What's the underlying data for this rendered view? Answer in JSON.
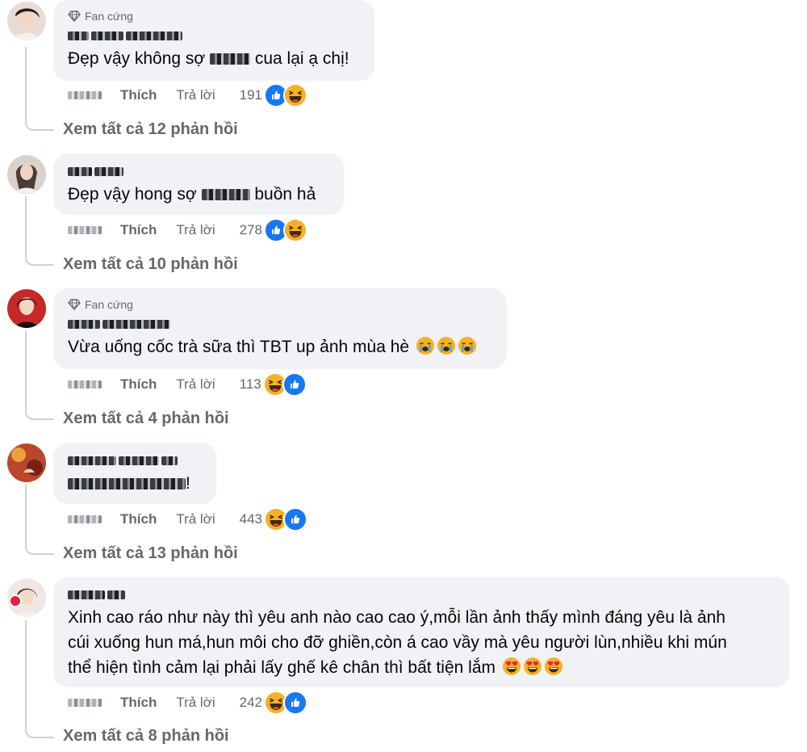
{
  "comments": [
    {
      "badge": "Fan cứng",
      "text": "Đẹp vậy không sợ ▒▒▒ cua lại ạ chị!",
      "text_parts": [
        "Đẹp vậy không sợ ",
        " cua lại ạ chị!"
      ],
      "actions": {
        "like": "Thích",
        "reply": "Trả lời",
        "count": "191"
      },
      "reactions": [
        "like",
        "haha"
      ],
      "see_more": "Xem tất cả 12 phản hồi"
    },
    {
      "badge": "",
      "text_parts": [
        "Đẹp vậy hong sợ ",
        " buồn hả"
      ],
      "actions": {
        "like": "Thích",
        "reply": "Trả lời",
        "count": "278"
      },
      "reactions": [
        "like",
        "haha"
      ],
      "see_more": "Xem tất cả 10 phản hồi"
    },
    {
      "badge": "Fan cứng",
      "text_parts": [
        "Vừa uống cốc trà sữa thì TBT up ảnh mùa hè"
      ],
      "emojis": [
        "crying-face",
        "crying-face",
        "crying-face"
      ],
      "actions": {
        "like": "Thích",
        "reply": "Trả lời",
        "count": "113"
      },
      "reactions": [
        "haha",
        "like"
      ],
      "see_more": "Xem tất cả 4 phản hồi"
    },
    {
      "badge": "",
      "text_parts": [
        "",
        "!"
      ],
      "actions": {
        "like": "Thích",
        "reply": "Trả lời",
        "count": "443"
      },
      "reactions": [
        "haha",
        "like"
      ],
      "see_more": "Xem tất cả 13 phản hồi"
    },
    {
      "badge": "",
      "text_parts": [
        "Xinh cao ráo như này thì yêu anh nào cao cao ý,mỗi lần ảnh thấy mình đáng yêu là ảnh\ncúi xuống hun má,hun môi cho đỡ ghiền,còn á cao vầy mà yêu người lùn,nhiều khi mún\nthể hiện tình cảm lại phải lấy ghế kê chân thì bất tiện lắm "
      ],
      "emojis": [
        "heart-eyes-face",
        "heart-eyes-face",
        "heart-eyes-face"
      ],
      "actions": {
        "like": "Thích",
        "reply": "Trả lời",
        "count": "242"
      },
      "reactions": [
        "haha",
        "like"
      ],
      "see_more": "Xem tất cả 8 phản hồi"
    }
  ],
  "colors": {
    "bubble": "#f0f2f5",
    "meta": "#65676b",
    "like_blue": "#1877f2",
    "haha_yellow": "#f7b125"
  },
  "icons": {
    "badge": "diamond-icon",
    "like": "thumbs-up-icon",
    "haha": "laughing-face-icon"
  }
}
